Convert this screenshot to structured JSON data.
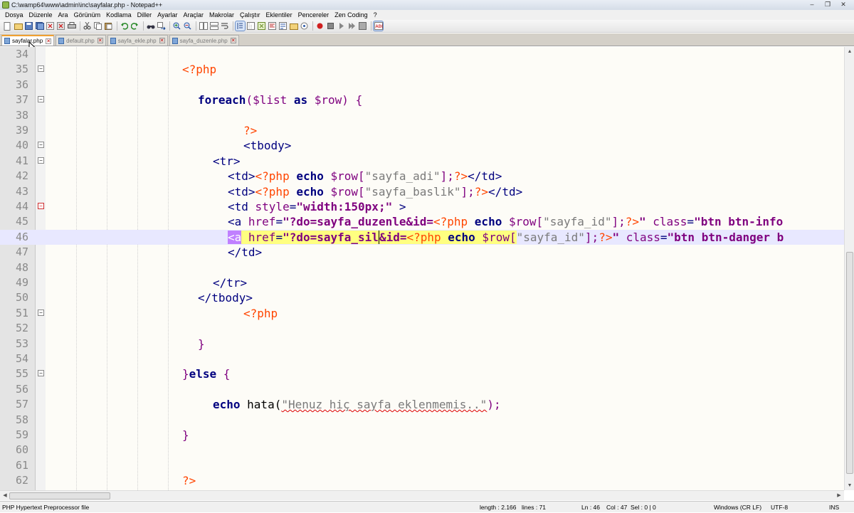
{
  "window": {
    "title": "C:\\wamp64\\www\\admin\\inc\\sayfalar.php - Notepad++",
    "controls": [
      "–",
      "❐",
      "✕"
    ]
  },
  "menu": [
    "Dosya",
    "Düzenle",
    "Ara",
    "Görünüm",
    "Kodlama",
    "Diller",
    "Ayarlar",
    "Araçlar",
    "Makrolar",
    "Çalıştır",
    "Eklentiler",
    "Pencereler",
    "Zen Coding",
    "?"
  ],
  "tabs": [
    {
      "label": "sayfalar.php",
      "active": true
    },
    {
      "label": "default.php",
      "active": false
    },
    {
      "label": "sayfa_ekle.php",
      "active": false
    },
    {
      "label": "sayfa_duzenle.php",
      "active": false
    }
  ],
  "editor": {
    "current_line": 46,
    "lines": [
      {
        "n": "34"
      },
      {
        "n": "35"
      },
      {
        "n": "36"
      },
      {
        "n": "37"
      },
      {
        "n": "38"
      },
      {
        "n": "39"
      },
      {
        "n": "40"
      },
      {
        "n": "41"
      },
      {
        "n": "42"
      },
      {
        "n": "43"
      },
      {
        "n": "44"
      },
      {
        "n": "45"
      },
      {
        "n": "46"
      },
      {
        "n": "47"
      },
      {
        "n": "48"
      },
      {
        "n": "49"
      },
      {
        "n": "50"
      },
      {
        "n": "51"
      },
      {
        "n": "52"
      },
      {
        "n": "53"
      },
      {
        "n": "54"
      },
      {
        "n": "55"
      },
      {
        "n": "56"
      },
      {
        "n": "57"
      },
      {
        "n": "58"
      },
      {
        "n": "59"
      },
      {
        "n": "60"
      },
      {
        "n": "61"
      },
      {
        "n": "62"
      }
    ],
    "code": {
      "l35": "<?php",
      "l37_kw": "foreach",
      "l37_a": "($list ",
      "l37_as": "as",
      "l37_b": " $row) {",
      "l39": "?>",
      "l40": "<tbody>",
      "l41": "<tr>",
      "l42_td": "<td>",
      "l42_php": "<?php ",
      "l42_echo": "echo",
      "l42_var": " $row[",
      "l42_key": "\"sayfa_adi\"",
      "l42_end": "];",
      "l42_close": "?>",
      "l42_tdc": "</td>",
      "l43_key": "\"sayfa_baslik\"",
      "l44_open": "<td ",
      "l44_attr": "style",
      "l44_eq": "=",
      "l44_val": "\"width:150px;\"",
      "l44_close": " >",
      "l45_a": "<a ",
      "l45_href": "href",
      "l45_val1": "\"?do=sayfa_duzenle&id=",
      "l45_php": "<?php ",
      "l45_echo": "echo",
      "l45_var": " $row[",
      "l45_key": "\"sayfa_id\"",
      "l45_end": "];",
      "l45_close": "?>",
      "l45_q": "\"",
      "l45_class": " class",
      "l45_cval": "\"btn btn-info",
      "l46_a": "<a",
      "l46_href": " href",
      "l46_val1": "\"?do=sayfa_sil",
      "l46_val2": "&id=",
      "l46_cval": "\"btn btn-danger b",
      "l47": "</td>",
      "l49": "</tr>",
      "l50": "</tbody>",
      "l51": "<?php",
      "l53": "}",
      "l55_a": "}",
      "l55_else": "else",
      "l55_b": " {",
      "l57_echo": "echo",
      "l57_fn": " hata(",
      "l57_str": "\"Henuz hiç sayfa eklenmemis..\"",
      "l57_end": ");",
      "l59": "}",
      "l62": "?>"
    }
  },
  "status": {
    "filetype": "PHP Hypertext Preprocessor file",
    "length": "length : 2.166",
    "lines": "lines : 71",
    "ln": "Ln : 46",
    "col": "Col : 47",
    "sel": "Sel : 0 | 0",
    "eol": "Windows (CR LF)",
    "encoding": "UTF-8",
    "mode": "INS"
  },
  "toolbar_icons": [
    "new-file-icon",
    "open-file-icon",
    "save-icon",
    "save-all-icon",
    "close-icon",
    "close-all-icon",
    "print-icon",
    "cut-icon",
    "copy-icon",
    "paste-icon",
    "undo-icon",
    "redo-icon",
    "find-icon",
    "replace-icon",
    "zoom-in-icon",
    "zoom-out-icon",
    "sync-v-icon",
    "sync-h-icon",
    "word-wrap-icon",
    "show-all-icon",
    "indent-guide-icon",
    "udl-icon",
    "doc-map-icon",
    "function-list-icon",
    "folder-workspace-icon",
    "monitoring-icon",
    "record-macro-icon",
    "stop-macro-icon",
    "play-macro-icon",
    "run-macro-icon",
    "save-macro-icon",
    "spellcheck-icon"
  ],
  "colors": {
    "keyword": "#00007f",
    "php_tag": "#ff4500",
    "attribute": "#7f007f",
    "current_line": "#e8e8ff",
    "highlight": "#ffff80"
  }
}
